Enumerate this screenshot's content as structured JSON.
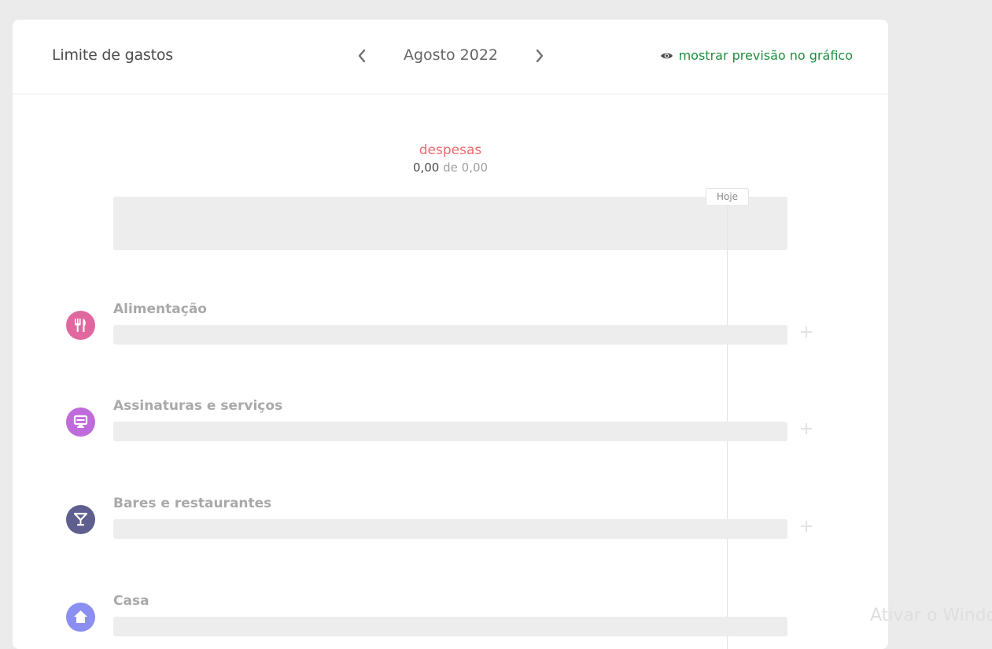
{
  "header": {
    "title": "Limite de gastos",
    "month": "Agosto 2022",
    "forecast_link": "mostrar previsão no gráfico",
    "prev_icon": "chevron-left-icon",
    "next_icon": "chevron-right-icon",
    "eye_icon": "eye-icon"
  },
  "summary": {
    "label": "despesas",
    "spent": "0,00",
    "separator": "de",
    "limit": "0,00",
    "today_label": "Hoje"
  },
  "categories": [
    {
      "name": "Alimentação",
      "icon": "fork-knife-icon",
      "color": "#e0689f"
    },
    {
      "name": "Assinaturas e serviços",
      "icon": "screen-icon",
      "color": "#c06bdb"
    },
    {
      "name": "Bares e restaurantes",
      "icon": "cocktail-icon",
      "color": "#5e5f8e"
    },
    {
      "name": "Casa",
      "icon": "house-icon",
      "color": "#8b8ff2"
    }
  ],
  "colors": {
    "accent_green": "#1e8e3e",
    "expense_red": "#f06a6a"
  },
  "watermark": "Ativar o Windows"
}
